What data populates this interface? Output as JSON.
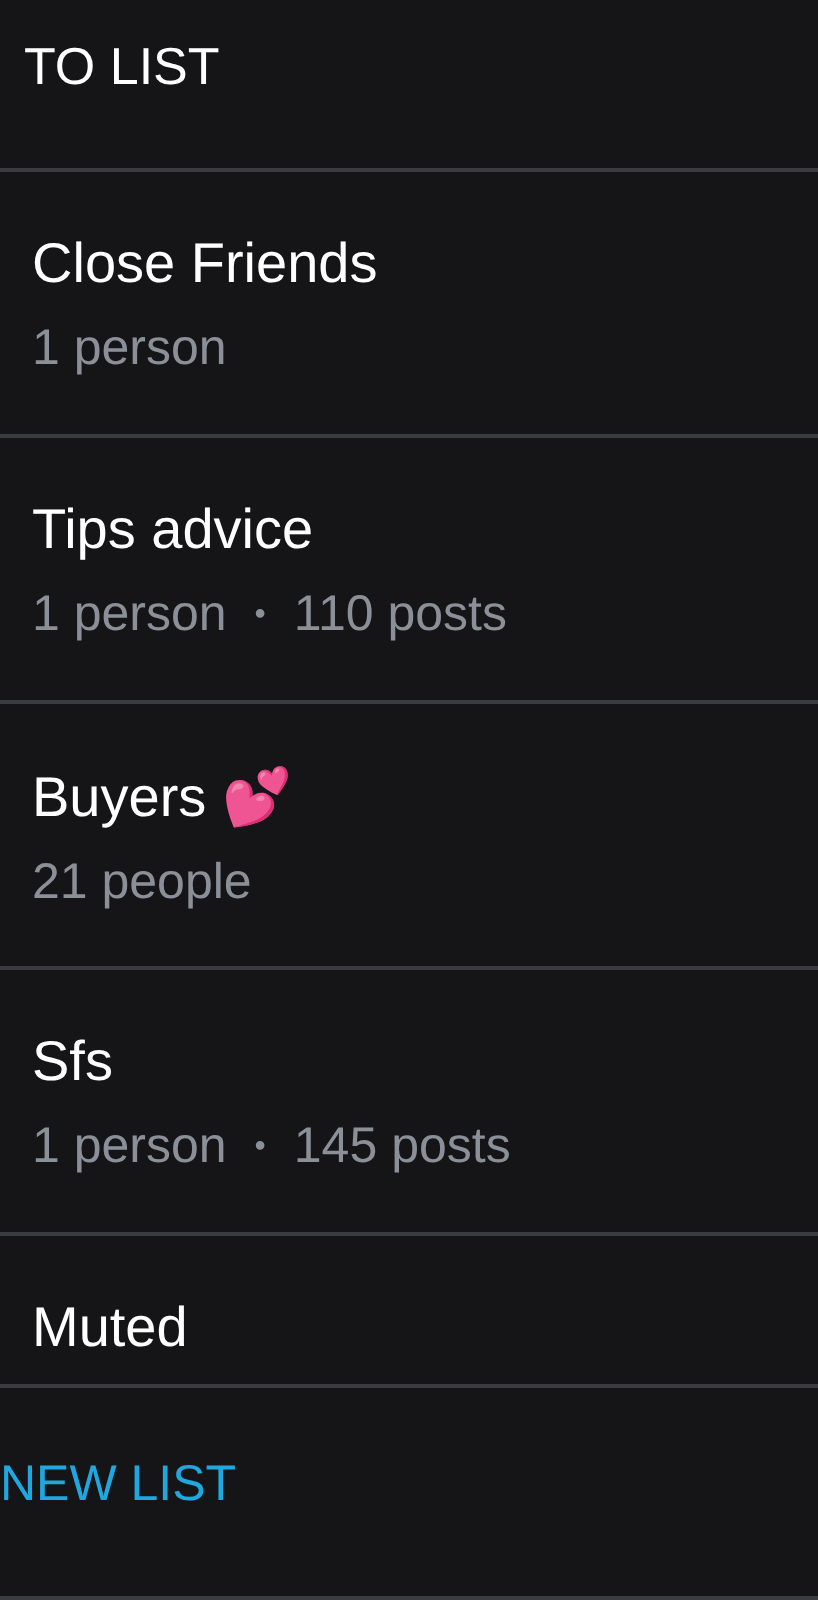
{
  "header": {
    "back_label": "TO LIST"
  },
  "meta_separator": "•",
  "lists": [
    {
      "name": "Close Friends",
      "meta": [
        "1 person"
      ]
    },
    {
      "name": "Tips advice",
      "meta": [
        "1 person",
        "110 posts"
      ]
    },
    {
      "name": "Buyers 💕",
      "meta": [
        "21 people"
      ]
    },
    {
      "name": "Sfs",
      "meta": [
        "1 person",
        "145 posts"
      ]
    },
    {
      "name": "Muted"
    }
  ],
  "new_list_button": "NEW LIST"
}
